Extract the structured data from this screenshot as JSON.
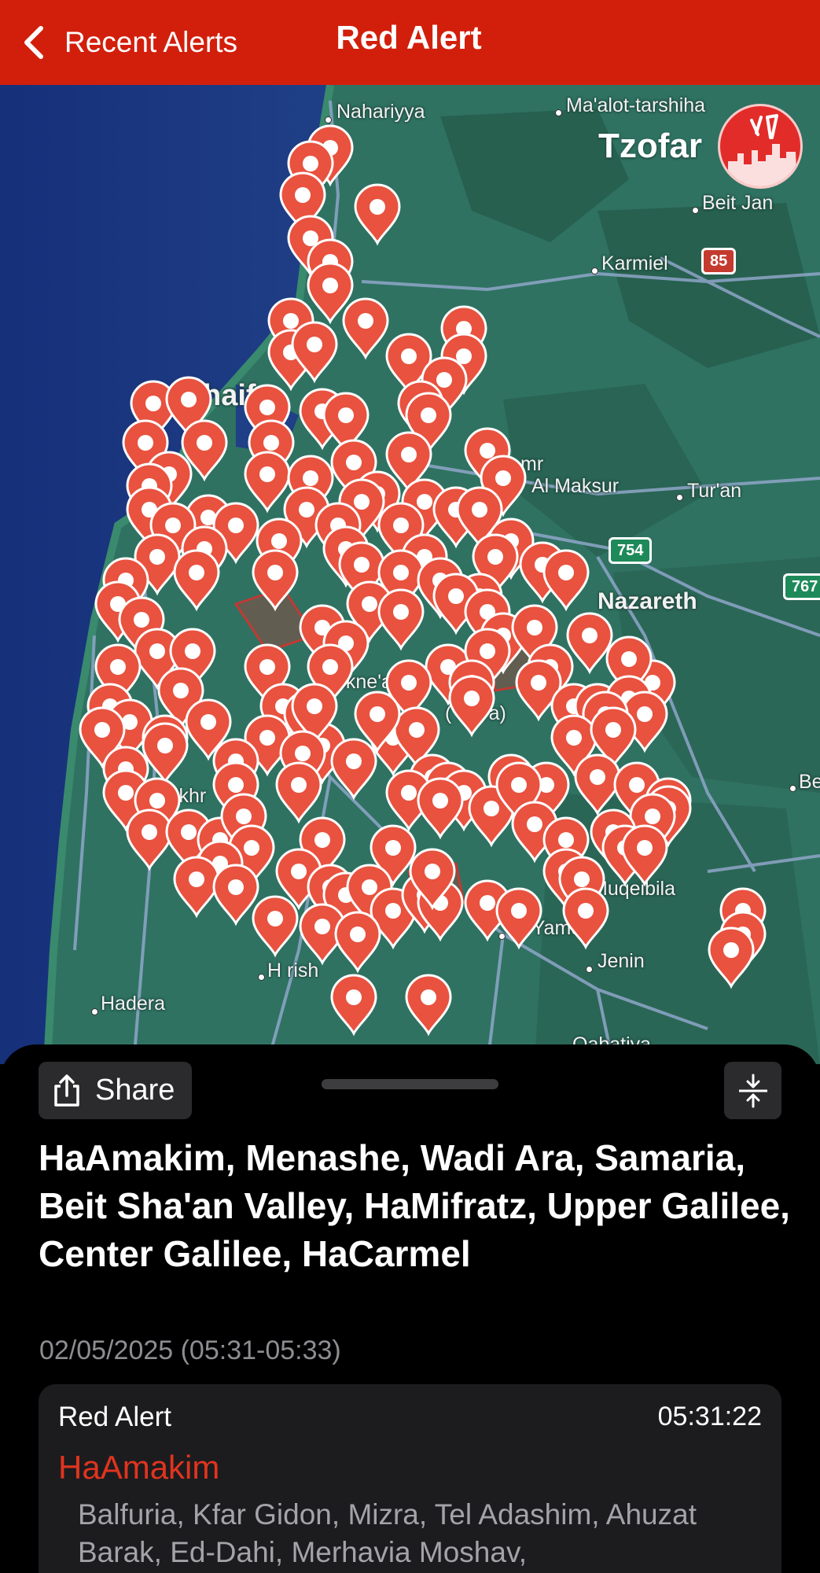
{
  "navbar": {
    "back_label": "Recent Alerts",
    "title": "Red Alert",
    "background_color": "#d21f0c"
  },
  "map": {
    "brand_name": "Tzofar",
    "labels": {
      "nahariyya": "Nahariyya",
      "maalot": "Ma'alot-tarshiha",
      "beit_jan": "Beit Jan",
      "karmiel": "Karmiel",
      "haifa": "haifa",
      "shfaram": "mr",
      "al_maksur": "Al Maksur",
      "turan": "Tur'an",
      "nazareth": "Nazareth",
      "yokneam": "okne'am",
      "ramat_hashofet": "(  hava)",
      "be": "Be",
      "ramat_elkhr": "kkhr",
      "muqeibila": "Muqeibila",
      "al_yamun": "Al Yamun",
      "jenin": "Jenin",
      "hadera": "Hadera",
      "harish": "H rish",
      "qabatiya": "Qabatiya"
    },
    "road_shields": {
      "r85": "85",
      "r754": "754",
      "r767": "767"
    },
    "pin_color": "#e8523f",
    "alert_zone_color": "#c03a33"
  },
  "sheet": {
    "share_label": "Share",
    "collapse_icon": "collapse-vertical-icon",
    "region_title": "HaAmakim, Menashe, Wadi Ara, Samaria, Beit Sha'an Valley, HaMifratz, Upper Galilee, Center Galilee, HaCarmel",
    "time_range": "02/05/2025 (05:31-05:33)",
    "alert": {
      "type": "Red Alert",
      "time": "05:31:22",
      "area": "HaAmakim",
      "area_color": "#e0341f",
      "cities": "Balfuria, Kfar Gidon, Mizra, Tel Adashim, Ahuzat Barak, Ed-Dahi, Merhavia Moshav,"
    }
  }
}
